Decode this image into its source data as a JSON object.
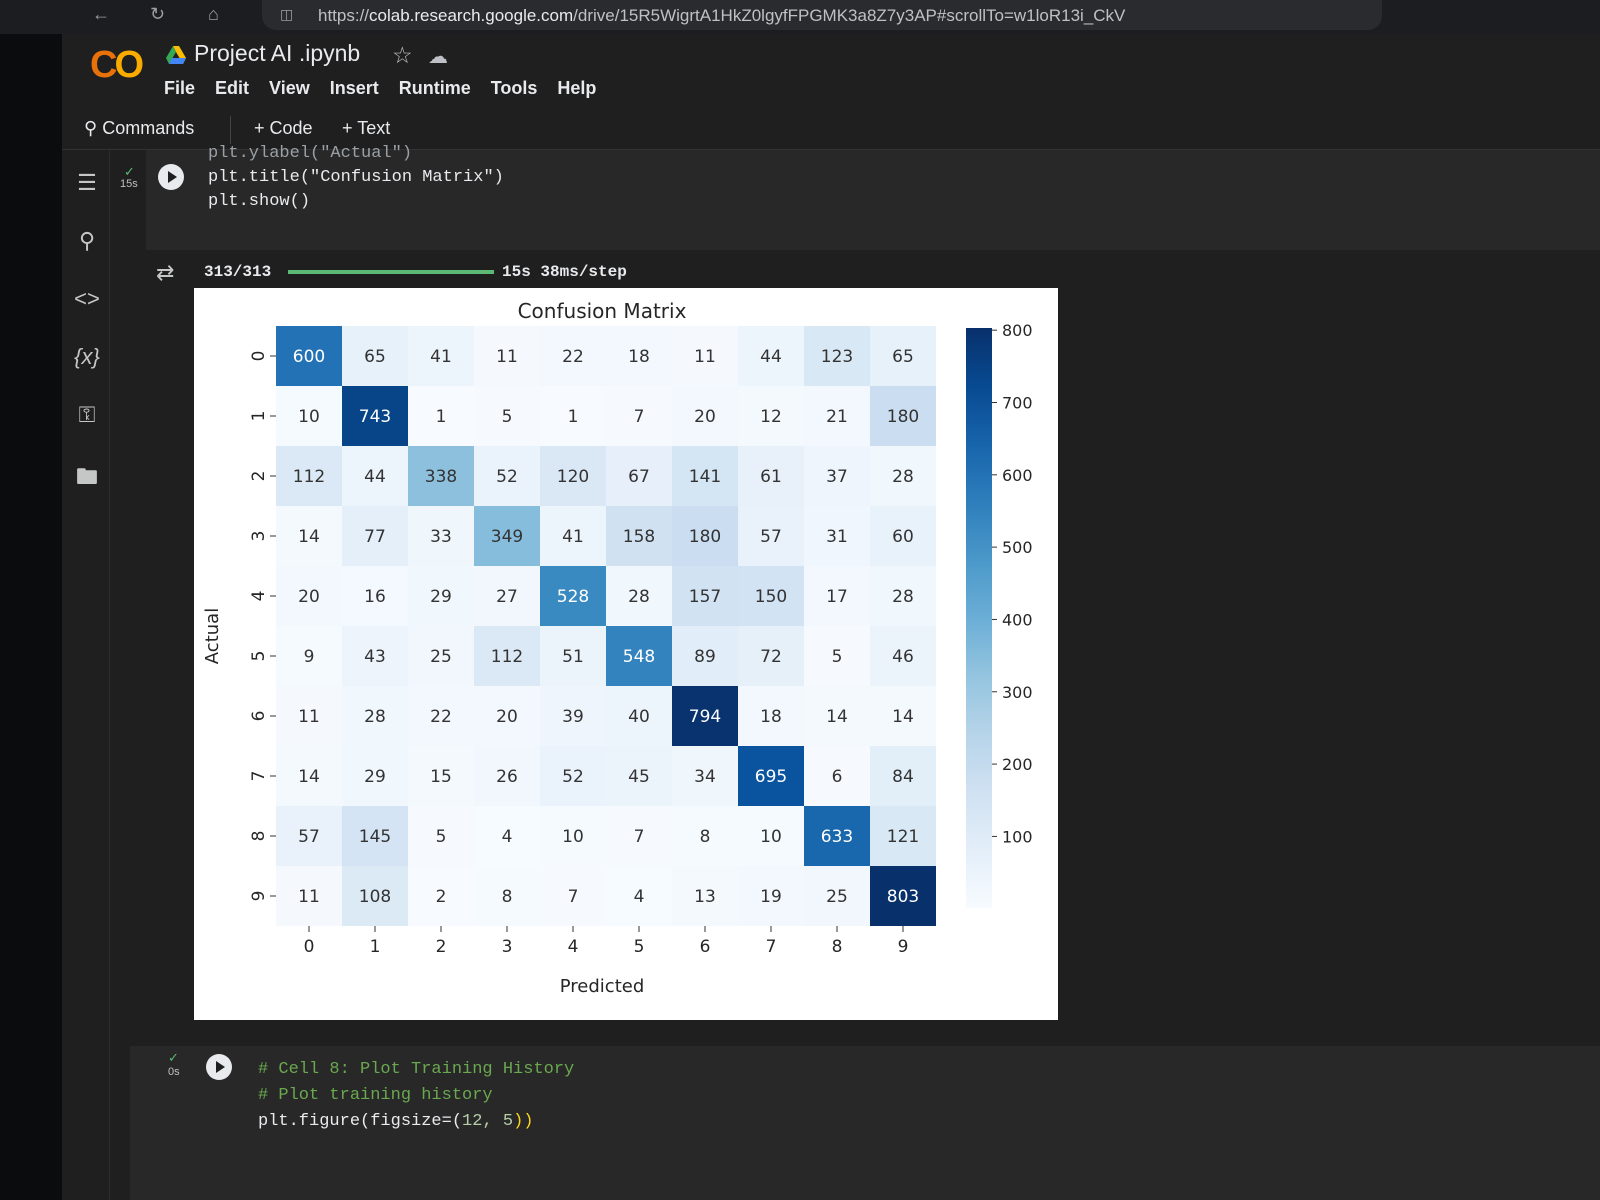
{
  "browser": {
    "url_prefix": "https://",
    "url_host": "colab.research.google.com",
    "url_path": "/drive/15R5WigrtA1HkZ0lgyfFPGMK3a8Z7y3AP#scrollTo=w1loR13i_CkV"
  },
  "header": {
    "logo_main": "C",
    "logo_accent": "O",
    "notebook_title": "Project AI .ipynb",
    "menu": [
      "File",
      "Edit",
      "View",
      "Insert",
      "Runtime",
      "Tools",
      "Help"
    ]
  },
  "toolbar": {
    "commands_label": "Commands",
    "code_label": "+ Code",
    "text_label": "+ Text"
  },
  "sidebar": {
    "icons": [
      "table-of-contents-icon",
      "find-replace-icon",
      "code-snippets-icon",
      "variables-icon",
      "secrets-key-icon",
      "files-folder-icon"
    ],
    "variables_glyph": "{x}"
  },
  "cell_1": {
    "status": "✓",
    "exec_time": "15s",
    "code_lines": [
      "plt.ylabel(\"Actual\")",
      "plt.title(\"Confusion Matrix\")",
      "plt.show()"
    ]
  },
  "output": {
    "progress_label": "313/313",
    "progress_fraction": 1.0,
    "progress_time": "15s 38ms/step"
  },
  "cell_2": {
    "status": "✓",
    "exec_time": "0s",
    "comment_1": "# Cell 8: Plot Training History",
    "comment_2": "# Plot training history",
    "code_prefix": "plt.figure(figsize=(",
    "code_nums": "12, 5",
    "code_suffix": "))"
  },
  "chart_data": {
    "type": "heatmap",
    "title": "Confusion Matrix",
    "xlabel": "Predicted",
    "ylabel": "Actual",
    "x_categories": [
      "0",
      "1",
      "2",
      "3",
      "4",
      "5",
      "6",
      "7",
      "8",
      "9"
    ],
    "y_categories": [
      "0",
      "1",
      "2",
      "3",
      "4",
      "5",
      "6",
      "7",
      "8",
      "9"
    ],
    "values": [
      [
        600,
        65,
        41,
        11,
        22,
        18,
        11,
        44,
        123,
        65
      ],
      [
        10,
        743,
        1,
        5,
        1,
        7,
        20,
        12,
        21,
        180
      ],
      [
        112,
        44,
        338,
        52,
        120,
        67,
        141,
        61,
        37,
        28
      ],
      [
        14,
        77,
        33,
        349,
        41,
        158,
        180,
        57,
        31,
        60
      ],
      [
        20,
        16,
        29,
        27,
        528,
        28,
        157,
        150,
        17,
        28
      ],
      [
        9,
        43,
        25,
        112,
        51,
        548,
        89,
        72,
        5,
        46
      ],
      [
        11,
        28,
        22,
        20,
        39,
        40,
        794,
        18,
        14,
        14
      ],
      [
        14,
        29,
        15,
        26,
        52,
        45,
        34,
        695,
        6,
        84
      ],
      [
        57,
        145,
        5,
        4,
        10,
        7,
        8,
        10,
        633,
        121
      ],
      [
        11,
        108,
        2,
        8,
        7,
        4,
        13,
        19,
        25,
        803
      ]
    ],
    "colormap": "Blues",
    "colorbar_ticks": [
      100,
      200,
      300,
      400,
      500,
      600,
      700,
      800
    ],
    "value_range": [
      1,
      803
    ]
  }
}
